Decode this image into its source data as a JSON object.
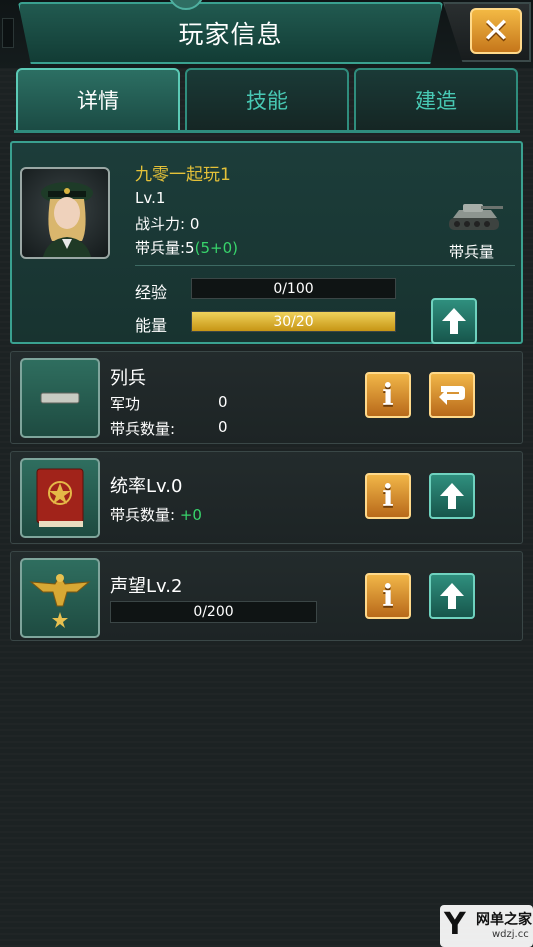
{
  "header": {
    "title": "玩家信息",
    "close_label": "✕"
  },
  "tabs": [
    {
      "label": "详情",
      "active": true
    },
    {
      "label": "技能",
      "active": false
    },
    {
      "label": "建造",
      "active": false
    }
  ],
  "profile": {
    "name": "九零一起玩1",
    "level": "Lv.1",
    "power": "战斗力: 0",
    "troops_prefix": "带兵量:5",
    "troops_bonus": "(5+0)",
    "troops_label": "带兵量",
    "exp_label": "经验",
    "exp_text": "0/100",
    "exp_fraction": 0,
    "energy_label": "能量",
    "energy_text": "30/20",
    "energy_fraction": 1
  },
  "cards": {
    "rank": {
      "title": "列兵",
      "merit_label": "军功",
      "merit_value": "0",
      "troops_label": "带兵数量:",
      "troops_value": "0"
    },
    "command": {
      "title": "统率Lv.0",
      "troops_label": "带兵数量:",
      "troops_value": "+0"
    },
    "prestige": {
      "title": "声望Lv.2",
      "progress_text": "0/200",
      "progress_fraction": 0
    }
  },
  "info_label": "i",
  "watermark": {
    "brand": "网单之家",
    "site": "wdzj.cc"
  },
  "colors": {
    "accent": "#3aa190",
    "gold": "#e4c139",
    "green": "#38d46b"
  }
}
